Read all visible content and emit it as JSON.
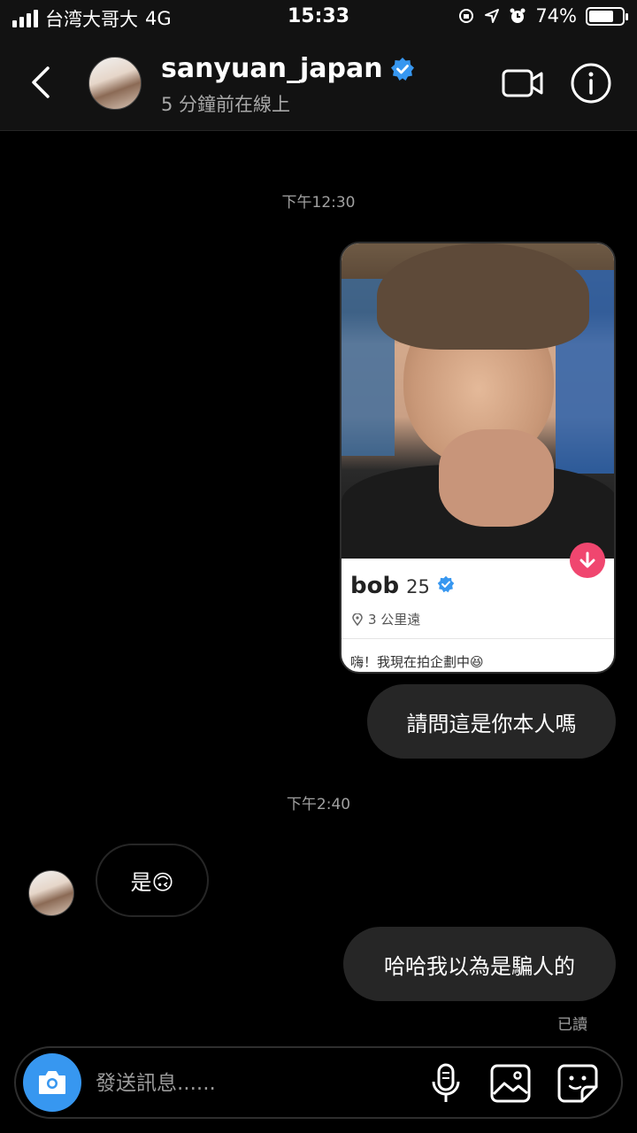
{
  "status_bar": {
    "carrier": "台湾大哥大",
    "network": "4G",
    "time": "15:33",
    "battery": "74%",
    "battery_level": 0.74
  },
  "header": {
    "username": "sanyuan_japan",
    "status": "5 分鐘前在線上",
    "verified_color": "#3797f0"
  },
  "messages": {
    "timestamp_1": "下午12:30",
    "shared_card": {
      "name": "bob",
      "age": "25",
      "distance": "3 公里遠",
      "bio": "嗨！我現在拍企劃中😆"
    },
    "outgoing_1": "請問這是你本人嗎",
    "timestamp_2": "下午2:40",
    "incoming_1": "是🙃",
    "outgoing_2": "哈哈我以為是騙人的",
    "read_receipt": "已讀"
  },
  "composer": {
    "placeholder": "發送訊息......"
  },
  "icons": [
    "back-icon",
    "video-call-icon",
    "info-icon",
    "verified-badge-icon",
    "download-icon",
    "location-pin-icon",
    "camera-icon",
    "microphone-icon",
    "gallery-icon",
    "sticker-icon"
  ],
  "colors": {
    "background": "#000000",
    "bubble": "#262626",
    "accent_blue": "#3797f0",
    "tinder_pink": "#f0466f"
  }
}
